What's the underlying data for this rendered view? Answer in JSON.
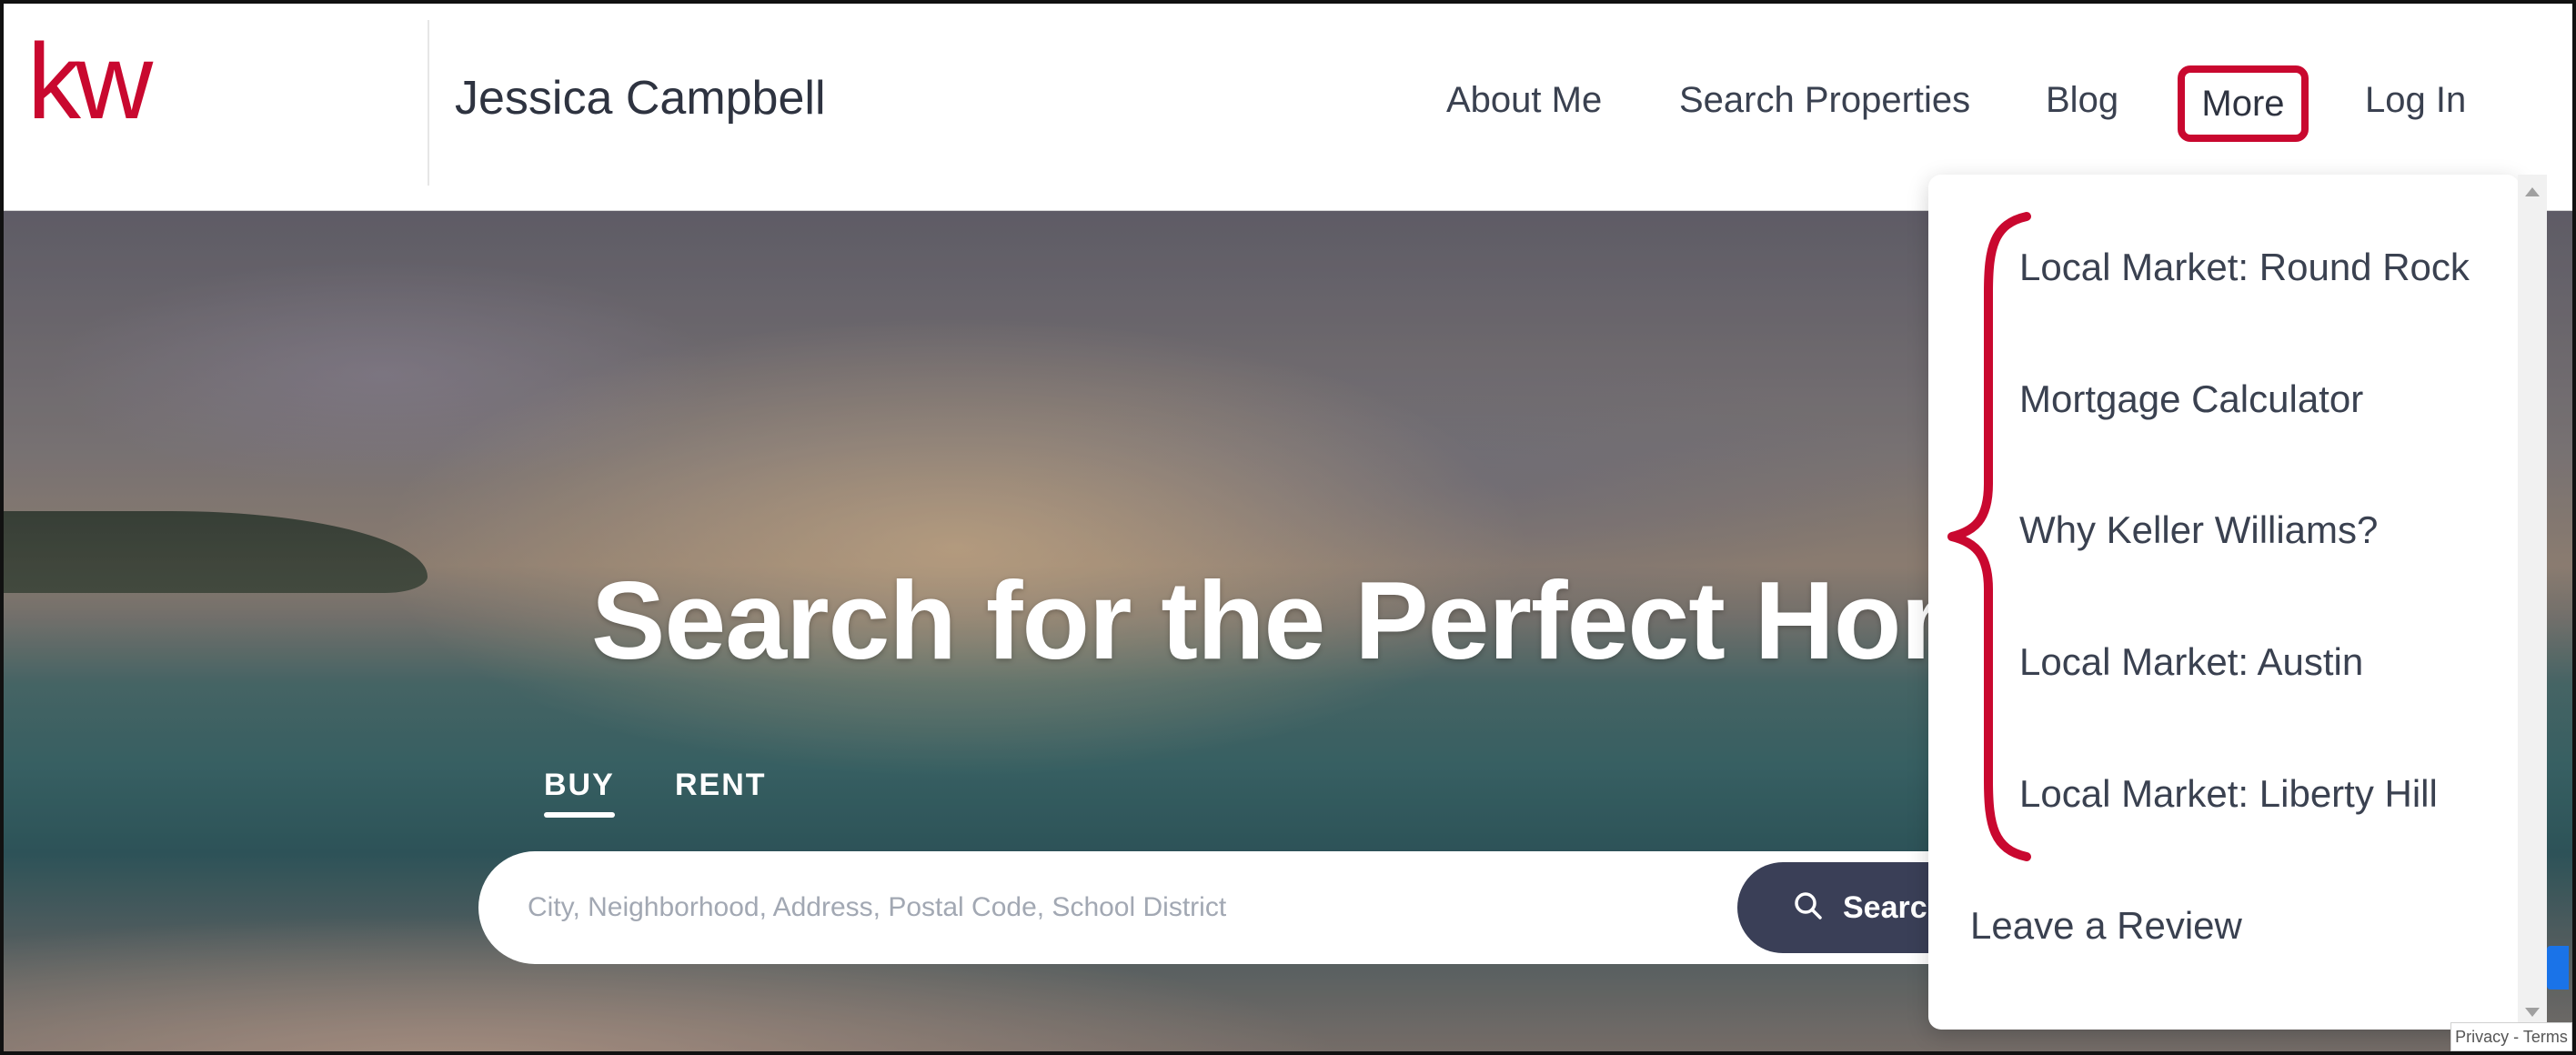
{
  "header": {
    "logo_text": "kw",
    "agent_name": "Jessica Campbell",
    "nav": {
      "about": "About Me",
      "search": "Search Properties",
      "blog": "Blog",
      "more": "More",
      "login": "Log In"
    }
  },
  "hero": {
    "title": "Search for the Perfect Home",
    "tabs": {
      "buy": "BUY",
      "rent": "RENT"
    },
    "search": {
      "placeholder": "City, Neighborhood, Address, Postal Code, School District",
      "button_label": "Search"
    }
  },
  "dropdown": {
    "items": [
      "Local Market: Round Rock",
      "Mortgage Calculator",
      "Why Keller Williams?",
      "Local Market: Austin",
      "Local Market: Liberty Hill"
    ],
    "last_item": "Leave a Review"
  },
  "footer": {
    "recaptcha_text": "Privacy - Terms"
  },
  "colors": {
    "brand": "#c9082f",
    "nav_text": "#3a4150",
    "search_button": "#3a3f57",
    "annotation": "#c9082f"
  }
}
